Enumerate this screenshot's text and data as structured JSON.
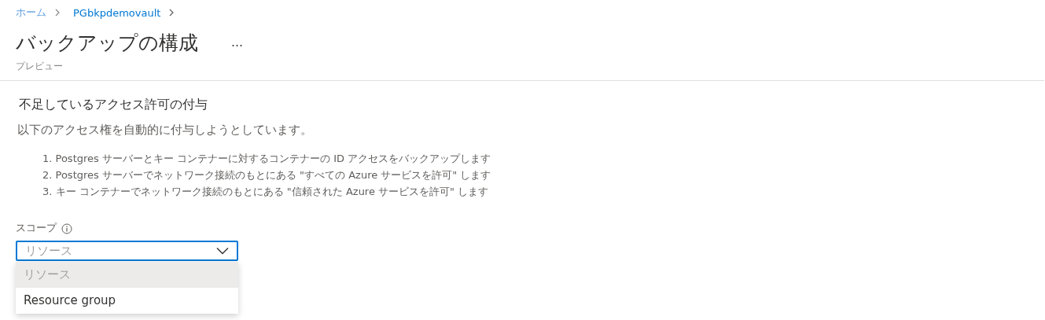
{
  "breadcrumb": [
    {
      "label": "ホーム"
    },
    {
      "label": "PGbkpdemovault"
    }
  ],
  "page": {
    "title": "バックアップの構成",
    "more": "…",
    "subtitle": "プレビュー"
  },
  "section": {
    "heading": "不足しているアクセス許可の付与",
    "description": "以下のアクセス権を自動的に付与しようとしています。",
    "steps": [
      "1. Postgres サーバーとキー コンテナーに対するコンテナーの ID アクセスをバックアップします",
      "2. Postgres サーバーでネットワーク接続のもとにある \"すべての Azure サービスを許可\" します",
      "3. キー コンテナーでネットワーク接続のもとにある \"信頼された Azure サービスを許可\" します"
    ]
  },
  "scope": {
    "label": "スコープ",
    "value": "リソース",
    "expanded": true,
    "options": [
      {
        "label": "リソース",
        "selected": true
      },
      {
        "label": "Resource group",
        "selected": false
      }
    ]
  }
}
